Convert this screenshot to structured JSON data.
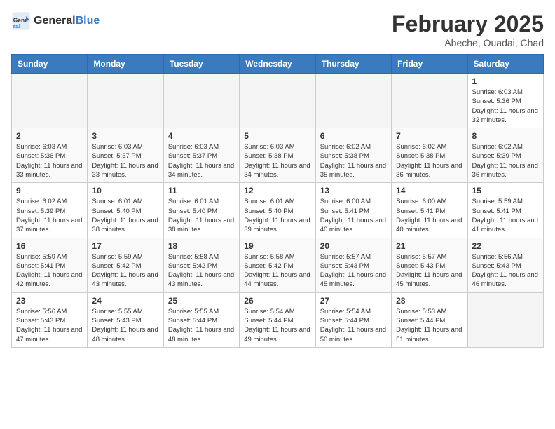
{
  "header": {
    "logo_line1": "General",
    "logo_line2": "Blue",
    "month": "February 2025",
    "location": "Abeche, Ouadai, Chad"
  },
  "weekdays": [
    "Sunday",
    "Monday",
    "Tuesday",
    "Wednesday",
    "Thursday",
    "Friday",
    "Saturday"
  ],
  "weeks": [
    [
      {
        "day": "",
        "info": ""
      },
      {
        "day": "",
        "info": ""
      },
      {
        "day": "",
        "info": ""
      },
      {
        "day": "",
        "info": ""
      },
      {
        "day": "",
        "info": ""
      },
      {
        "day": "",
        "info": ""
      },
      {
        "day": "1",
        "info": "Sunrise: 6:03 AM\nSunset: 5:36 PM\nDaylight: 11 hours and 32 minutes."
      }
    ],
    [
      {
        "day": "2",
        "info": "Sunrise: 6:03 AM\nSunset: 5:36 PM\nDaylight: 11 hours and 33 minutes."
      },
      {
        "day": "3",
        "info": "Sunrise: 6:03 AM\nSunset: 5:37 PM\nDaylight: 11 hours and 33 minutes."
      },
      {
        "day": "4",
        "info": "Sunrise: 6:03 AM\nSunset: 5:37 PM\nDaylight: 11 hours and 34 minutes."
      },
      {
        "day": "5",
        "info": "Sunrise: 6:03 AM\nSunset: 5:38 PM\nDaylight: 11 hours and 34 minutes."
      },
      {
        "day": "6",
        "info": "Sunrise: 6:02 AM\nSunset: 5:38 PM\nDaylight: 11 hours and 35 minutes."
      },
      {
        "day": "7",
        "info": "Sunrise: 6:02 AM\nSunset: 5:38 PM\nDaylight: 11 hours and 36 minutes."
      },
      {
        "day": "8",
        "info": "Sunrise: 6:02 AM\nSunset: 5:39 PM\nDaylight: 11 hours and 36 minutes."
      }
    ],
    [
      {
        "day": "9",
        "info": "Sunrise: 6:02 AM\nSunset: 5:39 PM\nDaylight: 11 hours and 37 minutes."
      },
      {
        "day": "10",
        "info": "Sunrise: 6:01 AM\nSunset: 5:40 PM\nDaylight: 11 hours and 38 minutes."
      },
      {
        "day": "11",
        "info": "Sunrise: 6:01 AM\nSunset: 5:40 PM\nDaylight: 11 hours and 38 minutes."
      },
      {
        "day": "12",
        "info": "Sunrise: 6:01 AM\nSunset: 5:40 PM\nDaylight: 11 hours and 39 minutes."
      },
      {
        "day": "13",
        "info": "Sunrise: 6:00 AM\nSunset: 5:41 PM\nDaylight: 11 hours and 40 minutes."
      },
      {
        "day": "14",
        "info": "Sunrise: 6:00 AM\nSunset: 5:41 PM\nDaylight: 11 hours and 40 minutes."
      },
      {
        "day": "15",
        "info": "Sunrise: 5:59 AM\nSunset: 5:41 PM\nDaylight: 11 hours and 41 minutes."
      }
    ],
    [
      {
        "day": "16",
        "info": "Sunrise: 5:59 AM\nSunset: 5:41 PM\nDaylight: 11 hours and 42 minutes."
      },
      {
        "day": "17",
        "info": "Sunrise: 5:59 AM\nSunset: 5:42 PM\nDaylight: 11 hours and 43 minutes."
      },
      {
        "day": "18",
        "info": "Sunrise: 5:58 AM\nSunset: 5:42 PM\nDaylight: 11 hours and 43 minutes."
      },
      {
        "day": "19",
        "info": "Sunrise: 5:58 AM\nSunset: 5:42 PM\nDaylight: 11 hours and 44 minutes."
      },
      {
        "day": "20",
        "info": "Sunrise: 5:57 AM\nSunset: 5:43 PM\nDaylight: 11 hours and 45 minutes."
      },
      {
        "day": "21",
        "info": "Sunrise: 5:57 AM\nSunset: 5:43 PM\nDaylight: 11 hours and 45 minutes."
      },
      {
        "day": "22",
        "info": "Sunrise: 5:56 AM\nSunset: 5:43 PM\nDaylight: 11 hours and 46 minutes."
      }
    ],
    [
      {
        "day": "23",
        "info": "Sunrise: 5:56 AM\nSunset: 5:43 PM\nDaylight: 11 hours and 47 minutes."
      },
      {
        "day": "24",
        "info": "Sunrise: 5:55 AM\nSunset: 5:43 PM\nDaylight: 11 hours and 48 minutes."
      },
      {
        "day": "25",
        "info": "Sunrise: 5:55 AM\nSunset: 5:44 PM\nDaylight: 11 hours and 48 minutes."
      },
      {
        "day": "26",
        "info": "Sunrise: 5:54 AM\nSunset: 5:44 PM\nDaylight: 11 hours and 49 minutes."
      },
      {
        "day": "27",
        "info": "Sunrise: 5:54 AM\nSunset: 5:44 PM\nDaylight: 11 hours and 50 minutes."
      },
      {
        "day": "28",
        "info": "Sunrise: 5:53 AM\nSunset: 5:44 PM\nDaylight: 11 hours and 51 minutes."
      },
      {
        "day": "",
        "info": ""
      }
    ]
  ]
}
